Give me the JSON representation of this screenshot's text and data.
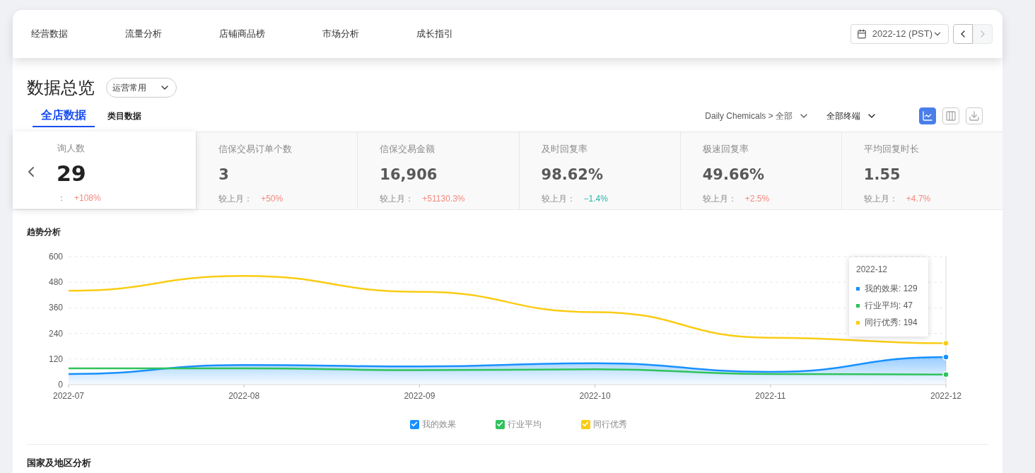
{
  "nav": {
    "items": [
      {
        "label": "经营数据",
        "selected": false
      },
      {
        "label": "流量分析",
        "selected": false
      },
      {
        "label": "店铺商品榜",
        "selected": false
      },
      {
        "label": "市场分析",
        "selected": false
      },
      {
        "label": "成长指引",
        "selected": false
      }
    ],
    "date": "2022-12 (PST)",
    "next_disabled": true
  },
  "header": {
    "title": "数据总览",
    "preset": "运营常用"
  },
  "tabs": [
    {
      "label": "全店数据",
      "selected": true
    },
    {
      "label": "类目数据",
      "selected": false
    }
  ],
  "filters": {
    "category": "Daily Chemicals > 全部",
    "terminal": "全部终端"
  },
  "view_modes": [
    {
      "kind": "line",
      "selected": true
    },
    {
      "kind": "columns",
      "selected": false
    },
    {
      "kind": "download",
      "selected": false
    }
  ],
  "metrics": [
    {
      "title": "询人数",
      "value": "29",
      "compare_label": "：",
      "delta": "+108%",
      "color": "#f28a7e",
      "raised": true
    },
    {
      "title": "信保交易订单个数",
      "value": "3",
      "compare_label": "较上月：",
      "delta": "+50%",
      "color": "#f28a7e",
      "raised": false
    },
    {
      "title": "信保交易金额",
      "value": "16,906",
      "compare_label": "较上月：",
      "delta": "+51130.3%",
      "color": "#f28a7e",
      "raised": false
    },
    {
      "title": "及时回复率",
      "value": "98.62%",
      "compare_label": "较上月：",
      "delta": "−1.4%",
      "color": "#2bb5a5",
      "raised": false
    },
    {
      "title": "极速回复率",
      "value": "49.66%",
      "compare_label": "较上月：",
      "delta": "+2.5%",
      "color": "#f28a7e",
      "raised": false
    },
    {
      "title": "平均回复时长",
      "value": "1.55",
      "compare_label": "较上月：",
      "delta": "+4.7%",
      "color": "#f28a7e",
      "raised": false
    }
  ],
  "trend": {
    "title": "趋势分析",
    "chart_data": {
      "type": "line",
      "categories": [
        "2022-07",
        "2022-08",
        "2022-09",
        "2022-10",
        "2022-11",
        "2022-12"
      ],
      "ylim": [
        0,
        600
      ],
      "yticks": [
        0,
        120,
        240,
        360,
        480,
        600
      ],
      "grid": true,
      "series": [
        {
          "name": "我的效果",
          "color": "#1890ff",
          "values": [
            50,
            92,
            85,
            100,
            60,
            129
          ]
        },
        {
          "name": "行业平均",
          "color": "#2fc25b",
          "values": [
            76,
            76,
            68,
            72,
            50,
            47
          ]
        },
        {
          "name": "同行优秀",
          "color": "#facc14",
          "values": [
            440,
            510,
            435,
            340,
            220,
            194
          ]
        }
      ]
    },
    "tooltip": {
      "title": "2022-12",
      "rows": [
        "我的效果: 129",
        "行业平均: 47",
        "同行优秀: 194"
      ]
    },
    "legend": [
      {
        "checked": true
      },
      {
        "checked": true
      },
      {
        "checked": true
      }
    ]
  },
  "region": {
    "title": "国家及地区分析"
  }
}
